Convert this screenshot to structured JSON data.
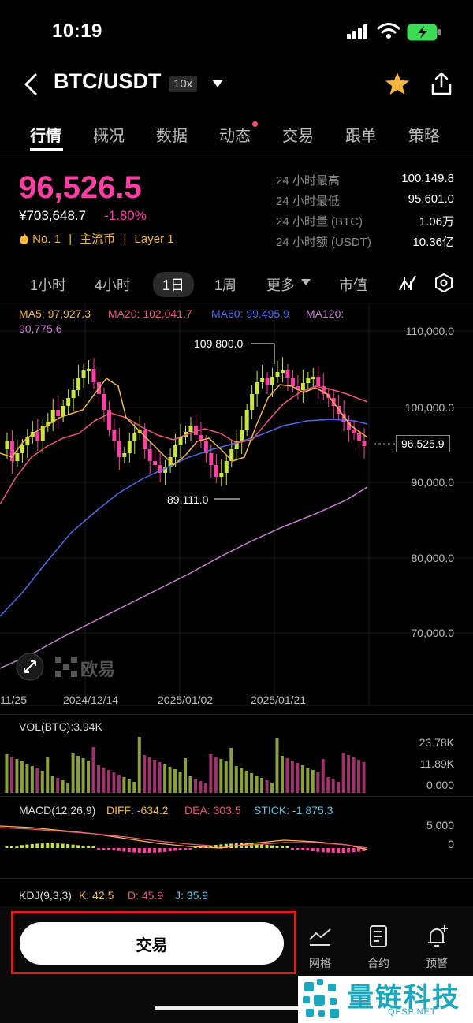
{
  "status": {
    "time": "10:19"
  },
  "header": {
    "pair": "BTC/USDT",
    "leverage": "10x"
  },
  "tabs": [
    {
      "label": "行情",
      "active": true
    },
    {
      "label": "概况"
    },
    {
      "label": "数据"
    },
    {
      "label": "动态",
      "dot": true
    },
    {
      "label": "交易"
    },
    {
      "label": "跟单"
    },
    {
      "label": "策略"
    }
  ],
  "ticker": {
    "last": "96,526.5",
    "cny": "¥703,648.7",
    "change": "-1.80%",
    "tags": [
      "No. 1",
      "|",
      "主流币",
      "|",
      "Layer 1"
    ],
    "stats": [
      {
        "label": "24 小时最高",
        "value": "100,149.8"
      },
      {
        "label": "24 小时最低",
        "value": "95,601.0"
      },
      {
        "label": "24 小时量 (BTC)",
        "value": "1.06万"
      },
      {
        "label": "24 小时额 (USDT)",
        "value": "10.36亿"
      }
    ]
  },
  "intervals": [
    "1小时",
    "4小时",
    "1日",
    "1周",
    "更多",
    "市值"
  ],
  "active_interval": "1日",
  "icons": {
    "indicators": "indicator-lines-icon",
    "settings": "hex-settings-icon",
    "expand": "expand-icon",
    "watermark": "okx-logo-icon"
  },
  "chart": {
    "ma_legend": [
      {
        "label": "MA5: 97,927.3",
        "color": "#f2b84b"
      },
      {
        "label": "MA20: 102,041.7",
        "color": "#e9577a"
      },
      {
        "label": "MA60: 99,495.9",
        "color": "#4b6be8"
      },
      {
        "label": "MA120:",
        "color": "#c77fd1"
      },
      {
        "label": "90,775.6",
        "color": "#c77fd1"
      }
    ],
    "y_ticks": [
      "110,000.0",
      "100,000.0",
      "90,000.0",
      "80,000.0",
      "70,000.0"
    ],
    "x_ticks": [
      "11/25",
      "2024/12/14",
      "2025/01/02",
      "2025/01/21"
    ],
    "high_label": "109,800.0",
    "low_label": "89,111.0",
    "current_price_label": "96,525.9",
    "brand": "欧易"
  },
  "volume": {
    "title": "VOL(BTC):3.94K",
    "ticks": [
      "23.78K",
      "11.89K",
      "0.000"
    ]
  },
  "macd": {
    "title": "MACD(12,26,9)",
    "diff": "DIFF: -634.2",
    "dea": "DEA: 303.5",
    "stick": "STICK: -1,875.3",
    "ticks": [
      "5,000",
      "0"
    ]
  },
  "kdj": {
    "title": "KDJ(9,3,3)",
    "k": "K: 42.5",
    "d": "D: 45.9",
    "j": "J: 35.9"
  },
  "bottom": {
    "trade": "交易",
    "items": [
      {
        "label": "网格"
      },
      {
        "label": "合约"
      },
      {
        "label": "预警"
      }
    ]
  },
  "watermark": {
    "title": "量链科技",
    "site": "QFSP.NET"
  },
  "colors": {
    "up": "#c8e640",
    "down": "#ff3ea5",
    "accent_star": "#f4b740"
  }
}
